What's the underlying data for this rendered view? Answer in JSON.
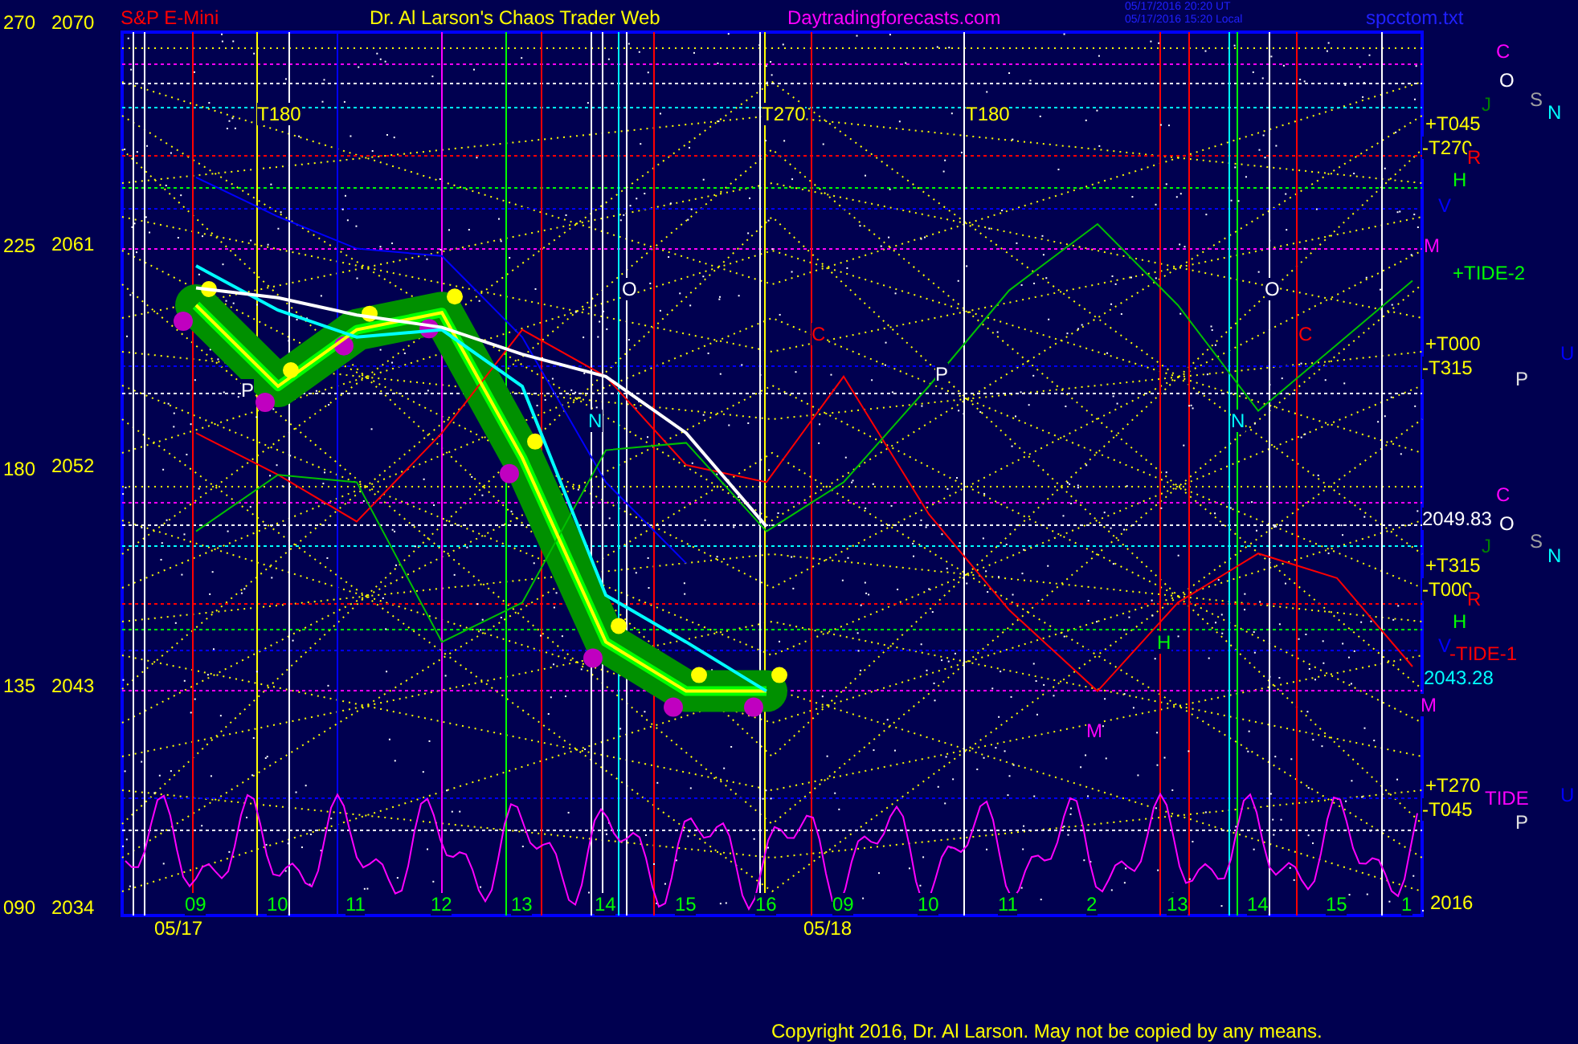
{
  "header": {
    "symbol": "S&P E-Mini",
    "title": "Dr. Al Larson's Chaos Trader Web",
    "site": "Daytradingforecasts.com",
    "timestamps": [
      "05/17/2016 20:20 UT",
      "05/17/2016 15:20 Local"
    ],
    "file": "spcctom.txt"
  },
  "degree_labels": [
    "270",
    "225",
    "180",
    "135",
    "090"
  ],
  "dates": [
    "05/17",
    "05/18"
  ],
  "chart_data": {
    "type": "line",
    "categories": [
      "09",
      "10",
      "11",
      "12",
      "13",
      "14",
      "15",
      "16",
      "09",
      "10",
      "11",
      "2",
      "13",
      "14",
      "15",
      "1"
    ],
    "ylim": [
      2034,
      2070
    ],
    "yticks": [
      {
        "value": 2070,
        "label": "2070"
      },
      {
        "value": 2061,
        "label": "2061"
      },
      {
        "value": 2052,
        "label": "2052"
      },
      {
        "value": 2043,
        "label": "2043"
      },
      {
        "value": 2034,
        "label": "2034"
      }
    ],
    "series": [
      {
        "color": "#ffff00",
        "values": [
          2058.5,
          2055.2,
          2057.5,
          2058.2,
          2052.3,
          2044.8,
          2042.8,
          2042.8,
          null,
          null,
          null,
          null,
          null,
          null,
          null,
          null
        ]
      },
      {
        "color": "#00ffff",
        "values": [
          2060.1,
          2058.3,
          2057.2,
          2057.5,
          2055.2,
          2046.7,
          2044.8,
          2042.8,
          null,
          null,
          null,
          null,
          null,
          null,
          null,
          null
        ]
      },
      {
        "color": "#ffffff",
        "values": [
          2059.2,
          2058.8,
          2058.1,
          2057.6,
          2056.5,
          2055.6,
          2053.3,
          2049.5,
          null,
          null,
          null,
          null,
          null,
          null,
          null,
          null
        ]
      },
      {
        "color": "#ff0000",
        "values": [
          2053.3,
          2051.6,
          2049.7,
          2053.3,
          2057.5,
          2055.6,
          2052.0,
          2051.3,
          2055.6,
          2050.0,
          2046.1,
          2042.8,
          2046.4,
          2048.4,
          2047.4,
          2043.8
        ]
      },
      {
        "color": "#00c000",
        "values": [
          2049.3,
          2051.6,
          2051.3,
          2044.8,
          2046.4,
          2052.6,
          2052.9,
          2049.3,
          2051.3,
          2055.2,
          2059.1,
          2061.8,
          2058.5,
          2054.2,
          2056.9,
          2059.5
        ]
      },
      {
        "color": "#0000ff",
        "values": [
          2063.7,
          2062.1,
          2060.8,
          2060.5,
          2057.2,
          2051.3,
          2048.0,
          null,
          null,
          null,
          null,
          null,
          null,
          null,
          null,
          null
        ]
      }
    ]
  },
  "plot_labels": [
    {
      "text": "T180",
      "color": "#ffff00"
    },
    {
      "text": "T270",
      "color": "#ffff00"
    },
    {
      "text": "T180",
      "color": "#ffff00"
    },
    {
      "text": "O",
      "color": "#ffffff"
    },
    {
      "text": "C",
      "color": "#ff0000"
    },
    {
      "text": "C",
      "color": "#ff0000"
    },
    {
      "text": "P",
      "color": "#ffffff"
    },
    {
      "text": "P",
      "color": "#ffffff"
    },
    {
      "text": "N",
      "color": "#00ffff"
    },
    {
      "text": "N",
      "color": "#00ffff"
    },
    {
      "text": "O",
      "color": "#ffffff"
    },
    {
      "text": "M",
      "color": "#ff00ff"
    },
    {
      "text": "H",
      "color": "#00ff00"
    }
  ],
  "right_labels": [
    {
      "text": "C",
      "color": "#ff00ff"
    },
    {
      "text": "O",
      "color": "#ffffff"
    },
    {
      "text": "J",
      "color": "#008000"
    },
    {
      "text": "S",
      "color": "#a0a0a0"
    },
    {
      "text": "N",
      "color": "#00ffff"
    },
    {
      "text": "+T045",
      "color": "#ffff00"
    },
    {
      "text": "-T270",
      "color": "#ffff00"
    },
    {
      "text": "R",
      "color": "#ff0000"
    },
    {
      "text": "H",
      "color": "#00ff00"
    },
    {
      "text": "V",
      "color": "#0000ff"
    },
    {
      "text": "M",
      "color": "#ff00ff"
    },
    {
      "text": "+TIDE-2",
      "color": "#00ff00"
    },
    {
      "text": "+T000",
      "color": "#ffff00"
    },
    {
      "text": "-T315",
      "color": "#ffff00"
    },
    {
      "text": "U",
      "color": "#0000ff"
    },
    {
      "text": "P",
      "color": "#e0e0e0"
    },
    {
      "text": "C",
      "color": "#ff00ff"
    },
    {
      "text": "2049.83",
      "color": "#ffffff"
    },
    {
      "text": "O",
      "color": "#ffffff"
    },
    {
      "text": "J",
      "color": "#008000"
    },
    {
      "text": "S",
      "color": "#a0a0a0"
    },
    {
      "text": "N",
      "color": "#00ffff"
    },
    {
      "text": "+T315",
      "color": "#ffff00"
    },
    {
      "text": "-T000",
      "color": "#ffff00"
    },
    {
      "text": "R",
      "color": "#ff0000"
    },
    {
      "text": "H",
      "color": "#00ff00"
    },
    {
      "text": "V",
      "color": "#0000ff"
    },
    {
      "text": "-TIDE-1",
      "color": "#ff0000"
    },
    {
      "text": "2043.28",
      "color": "#00ffff"
    },
    {
      "text": "M",
      "color": "#ff00ff"
    },
    {
      "text": "+T270",
      "color": "#ffff00"
    },
    {
      "text": "-T045",
      "color": "#ffff00"
    },
    {
      "text": "TIDE",
      "color": "#ff00ff"
    },
    {
      "text": "U",
      "color": "#0000ff"
    },
    {
      "text": "P",
      "color": "#e0e0e0"
    },
    {
      "text": "2016",
      "color": "#ffff00"
    }
  ],
  "copyright": "Copyright 2016, Dr. Al Larson. May not be copied by any means."
}
